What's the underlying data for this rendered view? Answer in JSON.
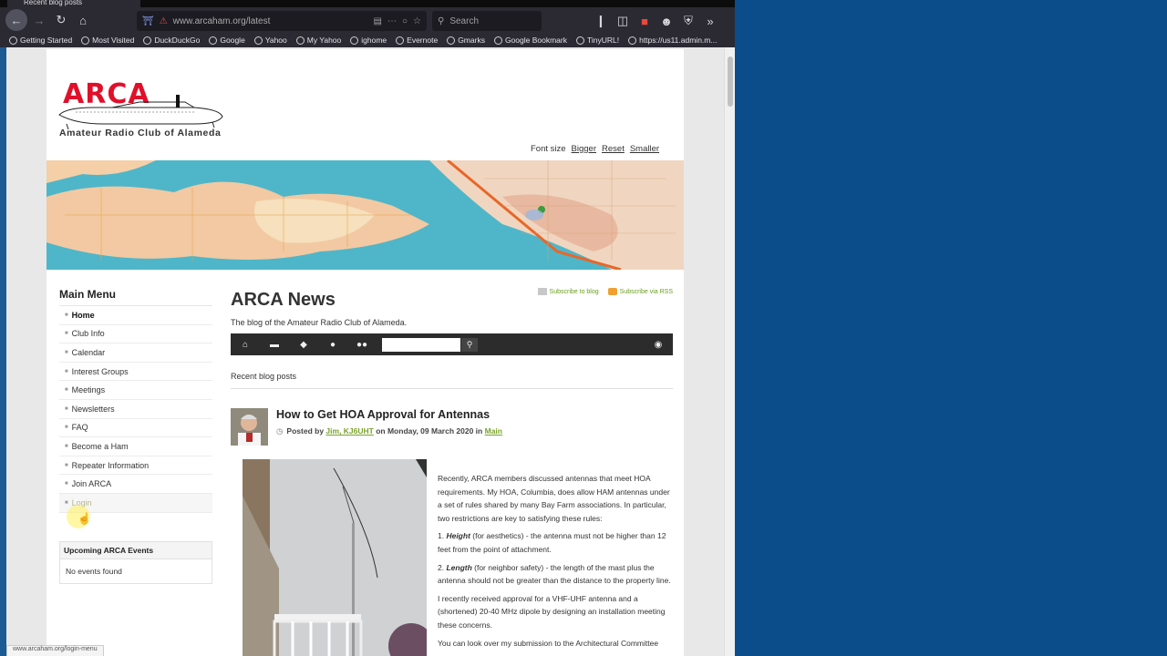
{
  "browser": {
    "tab_title": "Recent blog posts",
    "url": "www.arcaham.org/latest",
    "search_placeholder": "Search",
    "bookmarks": [
      "Getting Started",
      "Most Visited",
      "DuckDuckGo",
      "Google",
      "Yahoo",
      "My Yahoo",
      "ighome",
      "Evernote",
      "Gmarks",
      "Google Bookmark",
      "TinyURL!",
      "https://us11.admin.m..."
    ],
    "status_url": "www.arcaham.org/login-menu"
  },
  "site": {
    "logo": "ARCA",
    "club_name": "Amateur Radio Club of Alameda",
    "font_size_label": "Font size",
    "font_bigger": "Bigger",
    "font_reset": "Reset",
    "font_smaller": "Smaller"
  },
  "sidebar": {
    "title": "Main Menu",
    "items": [
      "Home",
      "Club Info",
      "Calendar",
      "Interest Groups",
      "Meetings",
      "Newsletters",
      "FAQ",
      "Become a Ham",
      "Repeater Information",
      "Join ARCA",
      "Login"
    ]
  },
  "events": {
    "header": "Upcoming ARCA Events",
    "body": "No events found"
  },
  "main": {
    "title": "ARCA News",
    "subscribe_blog": "Subscribe to blog",
    "subscribe_rss": "Subscribe via RSS",
    "description": "The blog of the Amateur Radio Club of Alameda.",
    "recent_label": "Recent blog posts"
  },
  "post": {
    "title": "How to Get HOA Approval for Antennas",
    "posted_by": "Posted by",
    "author": "Jim, KJ6UHT",
    "on_date": "on Monday, 09 March 2020 in",
    "category": "Main",
    "p1": "Recently, ARCA members discussed antennas that meet HOA requirements.  My HOA, Columbia, does allow HAM antennas under a set of rules shared by many Bay Farm associations. In particular, two restrictions are key to satisfying these rules:",
    "p2_label": "Height",
    "p2": " (for aesthetics) - the antenna must not be higher than 12 feet from the point of attachment.",
    "p3_label": "Length",
    "p3": " (for neighbor safety) - the length of the mast plus the antenna should not be greater than the distance to the property line.",
    "p4": "I recently received approval for a VHF-UHF antenna and a (shortened) 20-40 MHz dipole by designing an installation meeting these concerns.",
    "p5": "You can look over my submission to the Architectural Committee"
  },
  "colors": {
    "logo_red": "#e0102a",
    "link_green": "#7aa22c",
    "toolbar_dark": "#2c2c2c",
    "desktop_blue": "#0b4d8a"
  }
}
